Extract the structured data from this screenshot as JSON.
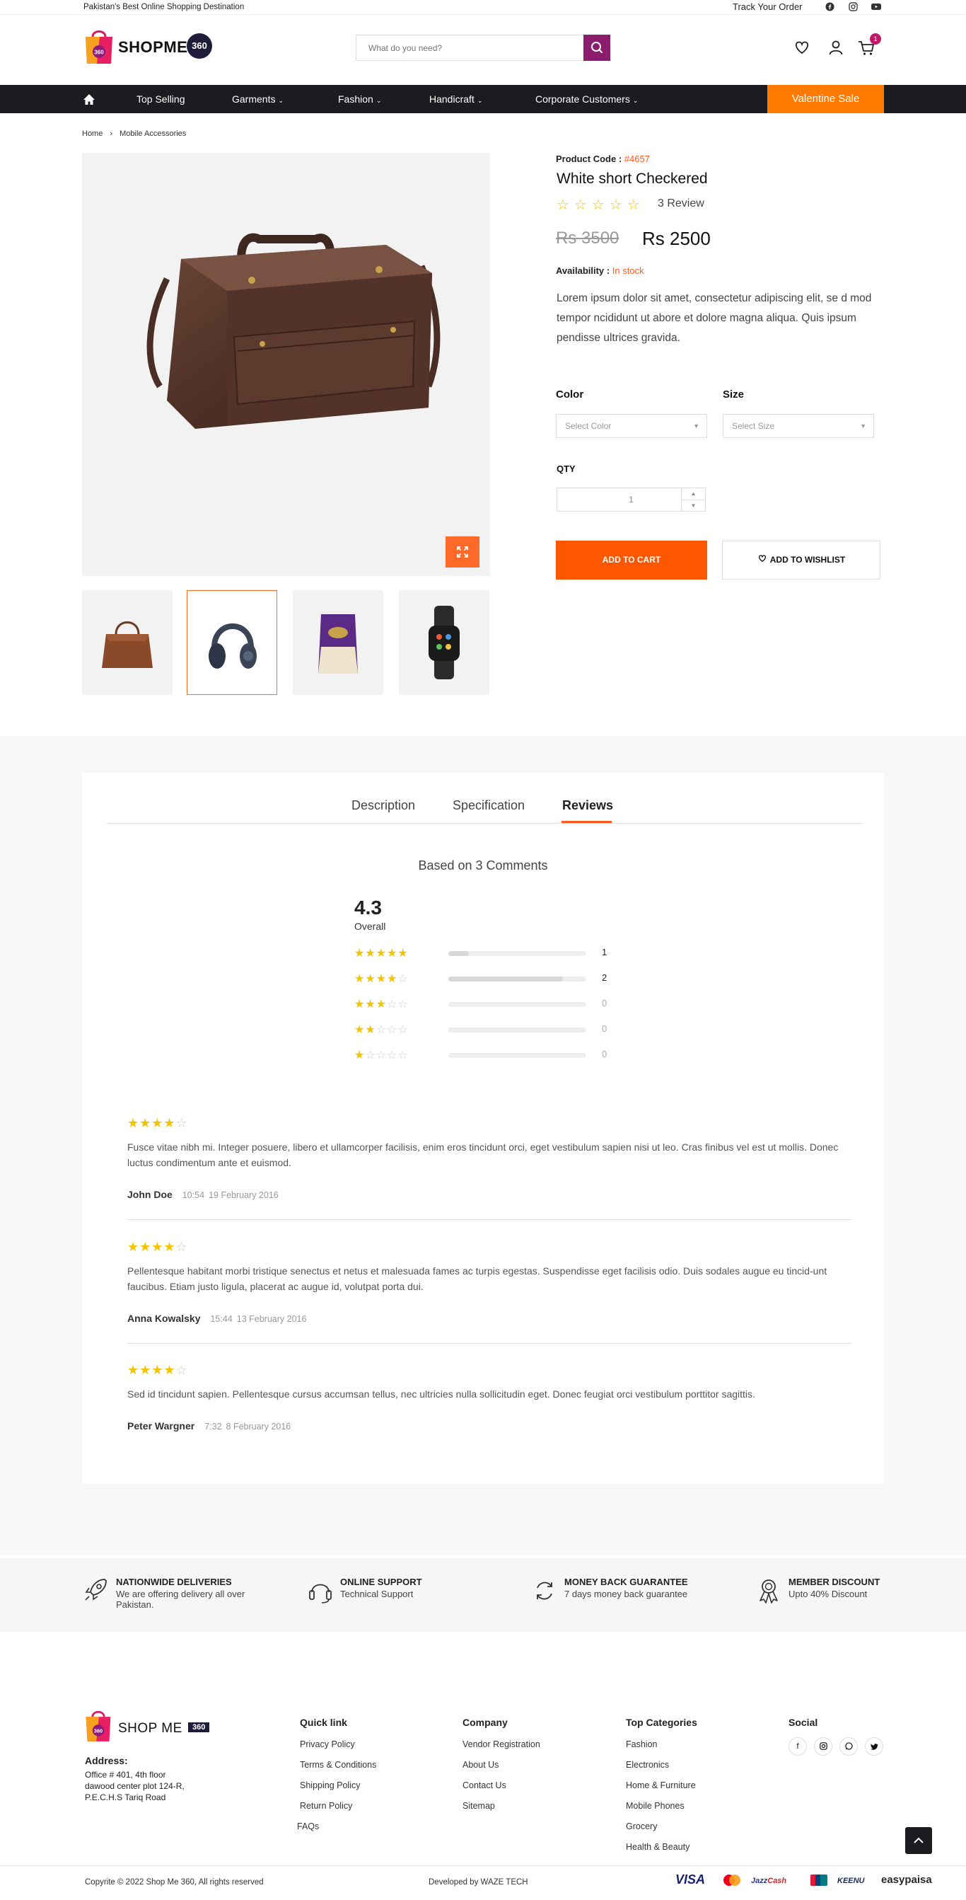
{
  "topbar": {
    "tagline": "Pakistan's Best Online Shopping Destination",
    "track_order": "Track Your Order",
    "social_icons": [
      "facebook-icon",
      "instagram-icon",
      "youtube-icon"
    ]
  },
  "header": {
    "logo_text": "SHOPME",
    "logo_badge": "360",
    "search_placeholder": "What do you need?",
    "cart_count": "1",
    "icons": [
      "heart-icon",
      "user-icon",
      "cart-icon"
    ]
  },
  "nav": {
    "items": [
      {
        "label": "Top Selling",
        "dropdown": false
      },
      {
        "label": "Garments",
        "dropdown": true
      },
      {
        "label": "Fashion",
        "dropdown": true
      },
      {
        "label": "Handicraft",
        "dropdown": true
      },
      {
        "label": "Corporate Customers",
        "dropdown": true
      }
    ],
    "sale_label": "Valentine Sale"
  },
  "breadcrumb": {
    "home": "Home",
    "current": "Mobile Accessories"
  },
  "product": {
    "code_label": "Product Code :",
    "code": "#4657",
    "title": "White short Checkered",
    "rating_stars": 5,
    "review_count": "3 Review",
    "old_price": "Rs 3500",
    "new_price": "Rs 2500",
    "availability_label": "Availability :",
    "availability": "In stock",
    "description": "Lorem ipsum dolor sit amet, consectetur adipiscing elit, se d mod tempor ncididunt ut abore et dolore magna aliqua. Quis ipsum pendisse ultrices gravida.",
    "color_label": "Color",
    "color_placeholder": "Select Color",
    "size_label": "Size",
    "size_placeholder": "Select Size",
    "qty_label": "QTY",
    "qty_value": "1",
    "add_to_cart": "ADD TO CART",
    "add_to_wishlist": "ADD TO WISHLIST",
    "thumbnails": [
      "handbag",
      "headphones",
      "rice-pack",
      "smartwatch"
    ],
    "selected_thumbnail": 1
  },
  "tabs": {
    "items": [
      "Description",
      "Specification",
      "Reviews"
    ],
    "active": "Reviews"
  },
  "reviews_summary": {
    "based_on": "Based on 3 Comments",
    "overall_value": "4.3",
    "overall_label": "Overall",
    "breakdown": [
      {
        "stars": 5,
        "count": "1",
        "fraction": 0.15
      },
      {
        "stars": 4,
        "count": "2",
        "fraction": 0.83
      },
      {
        "stars": 3,
        "count": "0",
        "fraction": 0
      },
      {
        "stars": 2,
        "count": "0",
        "fraction": 0
      },
      {
        "stars": 1,
        "count": "0",
        "fraction": 0
      }
    ]
  },
  "reviews": [
    {
      "stars": 4,
      "text": "Fusce vitae nibh mi. Integer posuere, libero et ullamcorper facilisis, enim eros tincidunt orci, eget vestibulum sapien nisi ut leo. Cras finibus vel est ut mollis. Donec luctus condimentum ante et euismod.",
      "author": "John Doe",
      "time": "10:54",
      "date": "19 February 2016"
    },
    {
      "stars": 4,
      "text": "Pellentesque habitant morbi tristique senectus et netus et malesuada fames ac turpis egestas. Suspendisse eget facilisis odio. Duis sodales augue eu tincid-unt faucibus. Etiam justo ligula, placerat ac augue id, volutpat porta dui.",
      "author": "Anna Kowalsky",
      "time": "15:44",
      "date": "13 February 2016"
    },
    {
      "stars": 4,
      "text": "Sed id tincidunt sapien. Pellentesque cursus accumsan tellus, nec ultricies nulla sollicitudin eget. Donec feugiat orci vestibulum porttitor sagittis.",
      "author": "Peter Wargner",
      "time": "7:32",
      "date": "8 February 2016"
    }
  ],
  "features": [
    {
      "title": "NATIONWIDE DELIVERIES",
      "subtitle": "We are offering delivery all over Pakistan.",
      "icon": "rocket-icon"
    },
    {
      "title": "ONLINE SUPPORT",
      "subtitle": "Technical Support",
      "icon": "headset-icon"
    },
    {
      "title": "MONEY BACK GUARANTEE",
      "subtitle": "7 days money back guarantee",
      "icon": "refresh-icon"
    },
    {
      "title": "MEMBER DISCOUNT",
      "subtitle": "Upto 40% Discount",
      "icon": "medal-icon"
    }
  ],
  "footer": {
    "logo_text": "SHOP ME",
    "logo_badge": "360",
    "address_heading": "Address:",
    "address_lines": [
      "Office # 401, 4th floor",
      "dawood center plot 124-R,",
      "P.E.C.H.S Tariq Road"
    ],
    "quick_link": {
      "heading": "Quick link",
      "links": [
        "Privacy Policy",
        "Terms & Conditions",
        "Shipping Policy",
        "Return Policy",
        "FAQs"
      ]
    },
    "company": {
      "heading": "Company",
      "links": [
        "Vendor Registration",
        "About Us",
        "Contact Us",
        "Sitemap"
      ]
    },
    "top_categories": {
      "heading": "Top Categories",
      "links": [
        "Fashion",
        "Electronics",
        "Home & Furniture",
        "Mobile Phones",
        "Grocery",
        "Health & Beauty"
      ]
    },
    "social": {
      "heading": "Social",
      "icons": [
        "facebook-icon",
        "instagram-icon",
        "whatsapp-icon",
        "twitter-icon"
      ]
    },
    "copyright": "Copyrite © 2022 Shop Me 360, All rights reserved",
    "developed_by": "Developed by WAZE TECH",
    "payments": [
      "VISA",
      "mastercard",
      "jazzcash",
      "unionpay",
      "KEENU",
      "easypaisa"
    ]
  },
  "colors": {
    "accent": "#ff5a1f",
    "nav_bg": "#1c1c20",
    "sale_bg": "#ff7a00",
    "search_btn": "#8b1c6e",
    "star": "#f3c200"
  }
}
